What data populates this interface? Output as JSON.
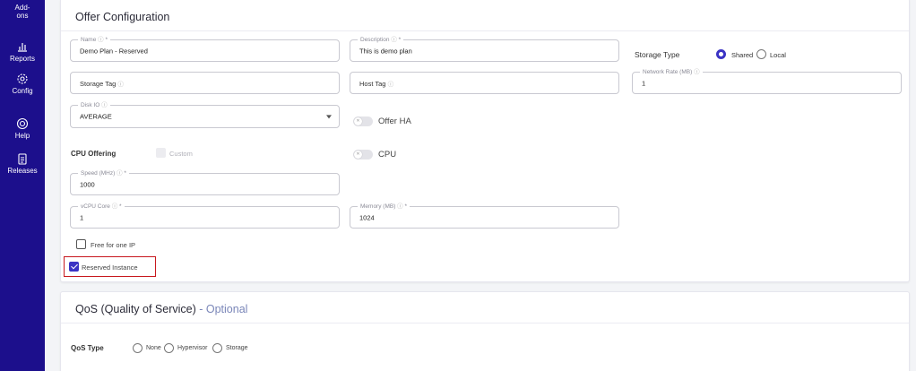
{
  "sidebar": {
    "items": [
      {
        "label": "Add-ons",
        "icon": "addons-icon"
      },
      {
        "label": "Reports",
        "icon": "bar-chart-icon"
      },
      {
        "label": "Config",
        "icon": "gear-icon"
      },
      {
        "label": "Help",
        "icon": "help-ring-icon"
      },
      {
        "label": "Releases",
        "icon": "clipboard-icon"
      }
    ],
    "addons_line1": "Add-",
    "addons_line2": "ons"
  },
  "offer": {
    "title": "Offer Configuration",
    "name_legend": "Name",
    "name_value": "Demo Plan - Reserved",
    "description_legend": "Description",
    "description_value": "This is demo plan",
    "storage_type_label": "Storage Type",
    "storage_shared": "Shared",
    "storage_local": "Local",
    "storage_tag_placeholder": "Storage Tag",
    "host_tag_placeholder": "Host Tag",
    "network_rate_legend": "Network Rate (MB)",
    "network_rate_value": "1",
    "disk_io_legend": "Disk IO",
    "disk_io_value": "AVERAGE",
    "offer_ha_label": "Offer HA",
    "cpu_offering_label": "CPU Offering",
    "custom_label": "Custom",
    "cpu_label": "CPU",
    "speed_legend": "Speed (MHz)",
    "speed_value": "1000",
    "vcpu_legend": "vCPU Core",
    "vcpu_value": "1",
    "memory_legend": "Memory (MB)",
    "memory_value": "1024",
    "free_ip_label": "Free for one IP",
    "reserved_label": "Reserved Instance",
    "required_mark": "*",
    "help_mark": "ⓘ"
  },
  "qos": {
    "title": "QoS (Quality of Service)",
    "optional": "- Optional",
    "type_label": "QoS Type",
    "opt_none": "None",
    "opt_hypervisor": "Hypervisor",
    "opt_storage": "Storage"
  },
  "colors": {
    "sidebar": "#1c0f8c",
    "accent": "#3b33c4",
    "highlight": "#c8181e",
    "optional": "#7a86b8"
  }
}
